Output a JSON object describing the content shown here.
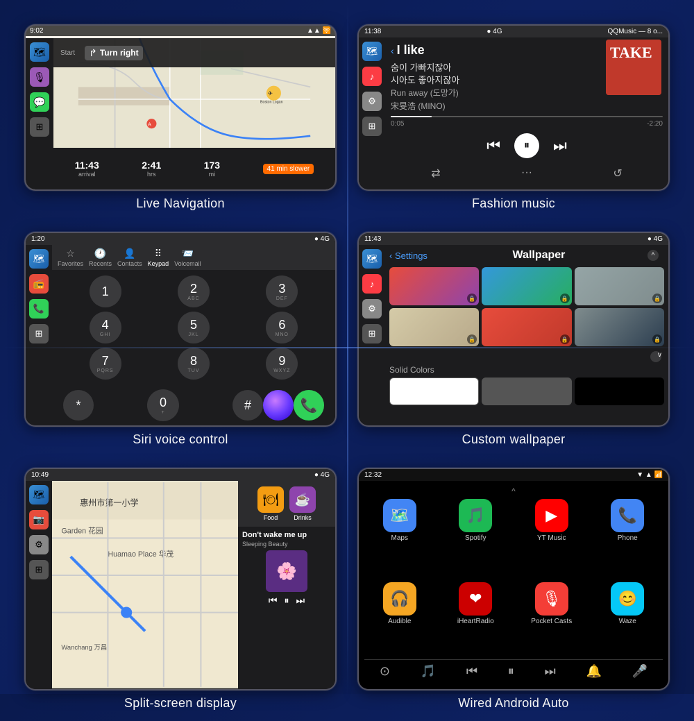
{
  "background": "#0a1a4e",
  "cells": [
    {
      "id": "nav",
      "label": "Live Navigation",
      "screen": {
        "time": "9:02",
        "signal": "▲▲▲",
        "wifi": "🛜",
        "direction": "Turn right",
        "start_label": "Start",
        "arrival_time": "11:43",
        "arrival_label": "arrival",
        "hrs": "2:41",
        "hrs_label": "hrs",
        "mi": "173",
        "mi_label": "mi",
        "slower": "41 min slower"
      }
    },
    {
      "id": "music",
      "label": "Fashion music",
      "screen": {
        "time": "11:38",
        "signal": "4G",
        "app": "QQMusic — 8 o...",
        "title": "I like",
        "lyrics1": "숨이 가빠지잖아",
        "lyrics2": "시아도 좋아지잖아",
        "lyrics3": "Run away (도망가)",
        "lyrics4": "宋旻浩 (MINO)",
        "time_current": "0:05",
        "time_total": "-2:20",
        "album_text": "TAKE"
      }
    },
    {
      "id": "siri",
      "label": "Siri voice control",
      "screen": {
        "time": "1:20",
        "signal": "4G",
        "tabs": [
          "Favorites",
          "Recents",
          "Contacts",
          "Keypad",
          "Voicemail"
        ],
        "active_tab": "Keypad",
        "buttons": [
          {
            "num": "1",
            "letters": ""
          },
          {
            "num": "2",
            "letters": "ABC"
          },
          {
            "num": "3",
            "letters": "DEF"
          },
          {
            "num": "4",
            "letters": "GHI"
          },
          {
            "num": "5",
            "letters": "JKL"
          },
          {
            "num": "6",
            "letters": "MNO"
          },
          {
            "num": "7",
            "letters": "PQRS"
          },
          {
            "num": "8",
            "letters": "TUV"
          },
          {
            "num": "9",
            "letters": "WXYZ"
          },
          {
            "num": "*",
            "letters": ""
          },
          {
            "num": "0",
            "letters": "+"
          },
          {
            "num": "#",
            "letters": ""
          }
        ]
      }
    },
    {
      "id": "wallpaper",
      "label": "Custom wallpaper",
      "screen": {
        "time": "11:43",
        "signal": "4G",
        "back_label": "Settings",
        "title": "Wallpaper",
        "solid_label": "Solid Colors",
        "thumbs": [
          {
            "colors": [
              "#e74c3c",
              "#8e44ad"
            ],
            "locked": true
          },
          {
            "colors": [
              "#3498db",
              "#27ae60"
            ],
            "locked": true
          },
          {
            "colors": [
              "#95a5a6",
              "#7f8c8d"
            ],
            "locked": true
          },
          {
            "colors": [
              "#d5cba8",
              "#b8a98a"
            ],
            "locked": true
          },
          {
            "colors": [
              "#e74c3c",
              "#c0392b"
            ],
            "locked": true
          },
          {
            "colors": [
              "#7f8c8d",
              "#2c3e50"
            ],
            "locked": true
          }
        ]
      }
    },
    {
      "id": "split",
      "label": "Split-screen display",
      "screen": {
        "time": "10:49",
        "signal": "4G",
        "poi_buttons": [
          "Food",
          "Drinks"
        ],
        "song": "Don't wake me up",
        "artist": "Sleeping Beauty"
      }
    },
    {
      "id": "android",
      "label": "Wired Android Auto",
      "screen": {
        "time": "12:32",
        "apps": [
          {
            "name": "Maps",
            "color": "#4285f4",
            "emoji": "🗺️"
          },
          {
            "name": "Spotify",
            "color": "#1db954",
            "emoji": "🎵"
          },
          {
            "name": "YT Music",
            "color": "#ff0000",
            "emoji": "▶"
          },
          {
            "name": "Phone",
            "color": "#4285f4",
            "emoji": "📞"
          },
          {
            "name": "Audible",
            "color": "#f5a623",
            "emoji": "🎧"
          },
          {
            "name": "iHeartRadio",
            "color": "#cc0000",
            "emoji": "❤"
          },
          {
            "name": "Pocket Casts",
            "color": "#f43e37",
            "emoji": "🎙"
          },
          {
            "name": "Waze",
            "color": "#05c8f7",
            "emoji": "🗺"
          }
        ]
      }
    }
  ]
}
